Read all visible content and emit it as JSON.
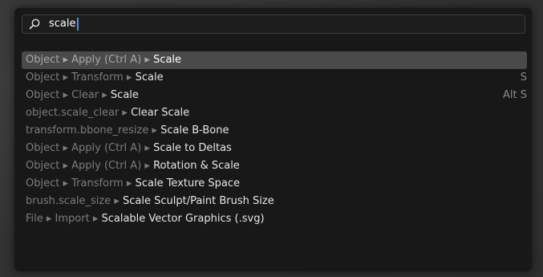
{
  "search": {
    "query": "scale"
  },
  "results": [
    {
      "path": "Object ▸ Apply (Ctrl A) ▸ ",
      "name": "Scale",
      "shortcut": "",
      "active": true
    },
    {
      "path": "Object ▸ Transform ▸ ",
      "name": "Scale",
      "shortcut": "S"
    },
    {
      "path": "Object ▸ Clear ▸ ",
      "name": "Scale",
      "shortcut": "Alt S"
    },
    {
      "path": "object.scale_clear ▸ ",
      "name": "Clear Scale",
      "shortcut": ""
    },
    {
      "path": "transform.bbone_resize ▸ ",
      "name": "Scale B-Bone",
      "shortcut": ""
    },
    {
      "path": "Object ▸ Apply (Ctrl A) ▸ ",
      "name": "Scale to Deltas",
      "shortcut": ""
    },
    {
      "path": "Object ▸ Apply (Ctrl A) ▸ ",
      "name": "Rotation & Scale",
      "shortcut": ""
    },
    {
      "path": "Object ▸ Transform ▸ ",
      "name": "Scale Texture Space",
      "shortcut": ""
    },
    {
      "path": "brush.scale_size ▸ ",
      "name": "Scale Sculpt/Paint Brush Size",
      "shortcut": ""
    },
    {
      "path": "File ▸ Import ▸ ",
      "name": "Scalable Vector Graphics (.svg)",
      "shortcut": ""
    }
  ]
}
